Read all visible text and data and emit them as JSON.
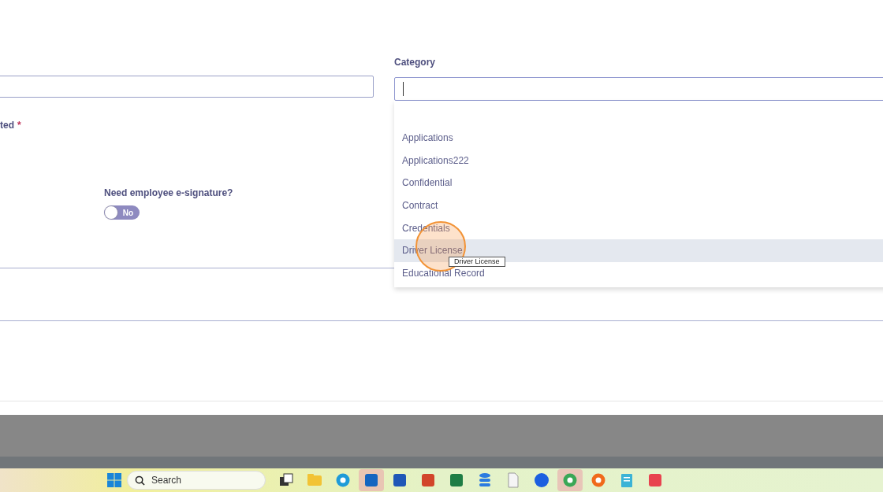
{
  "form": {
    "required_label": {
      "text": "ted",
      "required_mark": "*"
    },
    "esignature": {
      "label": "Need employee e-signature?",
      "toggle": {
        "on": false,
        "text": "No"
      }
    }
  },
  "category": {
    "label": "Category",
    "expanded": true,
    "options": [
      {
        "label": "Applications",
        "selected": false
      },
      {
        "label": "Applications222",
        "selected": false
      },
      {
        "label": "Confidential",
        "selected": false
      },
      {
        "label": "Contract",
        "selected": false
      },
      {
        "label": "Credentials",
        "selected": false
      },
      {
        "label": "Driver License",
        "selected": true
      },
      {
        "label": "Educational Record",
        "selected": false
      }
    ],
    "tooltip": "Driver License"
  },
  "taskbar": {
    "search": {
      "placeholder": "Search"
    },
    "apps": [
      {
        "kind": "taskview",
        "color": "#333333",
        "active": false
      },
      {
        "kind": "folder",
        "color": "#f2c335",
        "active": false
      },
      {
        "kind": "browser",
        "color": "#1f9bd8",
        "active": false
      },
      {
        "kind": "mail",
        "color": "#1565c0",
        "active": true
      },
      {
        "kind": "doc",
        "color": "#1f57b7",
        "active": false
      },
      {
        "kind": "slides",
        "color": "#d2452a",
        "active": false
      },
      {
        "kind": "sheet",
        "color": "#1e7d45",
        "active": false
      },
      {
        "kind": "stack",
        "color": "#2b7be0",
        "active": false
      },
      {
        "kind": "file",
        "color": "#f5f5f5",
        "active": false
      },
      {
        "kind": "video",
        "color": "#1b5fe0",
        "active": false
      },
      {
        "kind": "chrome",
        "color": "#3aa757",
        "active": true
      },
      {
        "kind": "firefox",
        "color": "#f06a1b",
        "active": false
      },
      {
        "kind": "notepad",
        "color": "#3bb3d6",
        "active": false
      },
      {
        "kind": "app",
        "color": "#e8434f",
        "active": false
      }
    ]
  }
}
